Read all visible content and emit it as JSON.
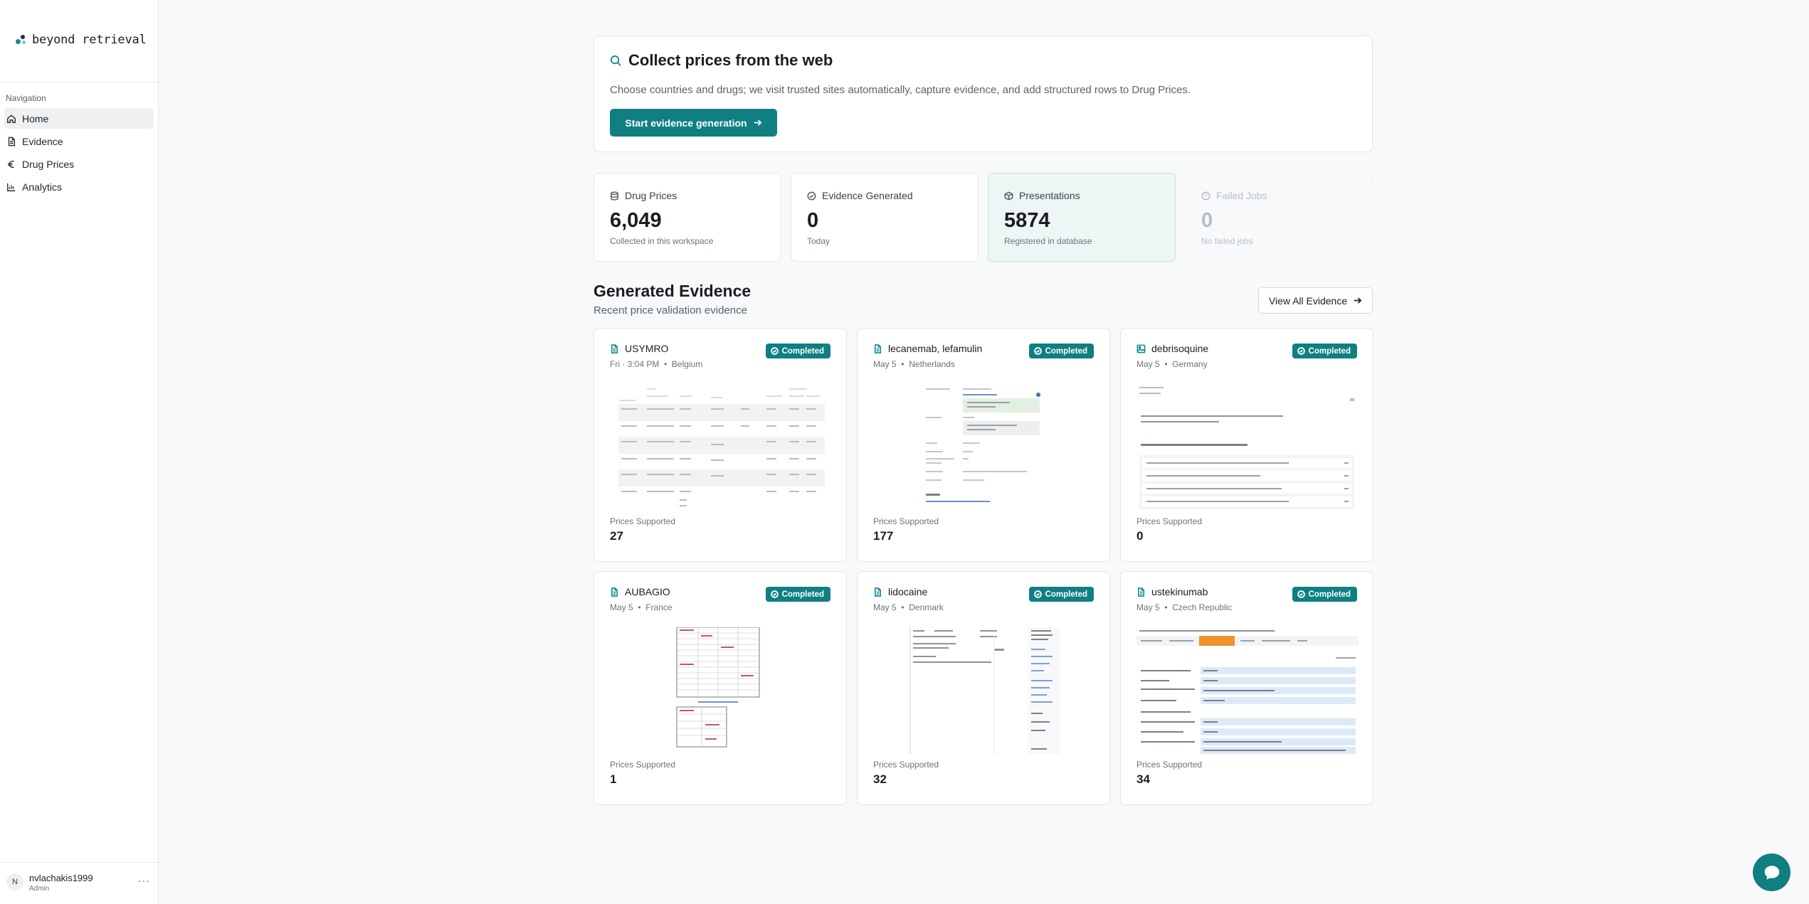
{
  "brand": {
    "name": "beyond retrieval"
  },
  "sidebar": {
    "nav_heading": "Navigation",
    "items": [
      {
        "label": "Home",
        "icon": "home-icon",
        "active": true
      },
      {
        "label": "Evidence",
        "icon": "document-icon",
        "active": false
      },
      {
        "label": "Drug Prices",
        "icon": "euro-icon",
        "active": false
      },
      {
        "label": "Analytics",
        "icon": "bar-chart-icon",
        "active": false
      }
    ],
    "user": {
      "initial": "N",
      "name": "nvlachakis1999",
      "role": "Admin",
      "menu": "···"
    }
  },
  "hero": {
    "title": "Collect prices from the web",
    "description": "Choose countries and drugs; we visit trusted sites automatically, capture evidence, and add structured rows to Drug Prices.",
    "button_label": "Start evidence generation"
  },
  "stats": [
    {
      "label": "Drug Prices",
      "value": "6,049",
      "sub": "Collected in this workspace"
    },
    {
      "label": "Evidence Generated",
      "value": "0",
      "sub": "Today"
    },
    {
      "label": "Presentations",
      "value": "5874",
      "sub": "Registered in database"
    },
    {
      "label": "Failed Jobs",
      "value": "0",
      "sub": "No failed jobs"
    }
  ],
  "section": {
    "title": "Generated Evidence",
    "subtitle": "Recent price validation evidence",
    "view_all_label": "View All Evidence"
  },
  "cards": [
    {
      "title": "USYMRO",
      "date": "Fri · 3:04 PM",
      "country": "Belgium",
      "status": "Completed",
      "prices_label": "Prices Supported",
      "prices": "27",
      "icon": "document-icon"
    },
    {
      "title": "lecanemab, lefamulin",
      "date": "May 5",
      "country": "Netherlands",
      "status": "Completed",
      "prices_label": "Prices Supported",
      "prices": "177",
      "icon": "document-icon"
    },
    {
      "title": "debrisoquine",
      "date": "May 5",
      "country": "Germany",
      "status": "Completed",
      "prices_label": "Prices Supported",
      "prices": "0",
      "icon": "image-icon"
    },
    {
      "title": "AUBAGIO",
      "date": "May 5",
      "country": "France",
      "status": "Completed",
      "prices_label": "Prices Supported",
      "prices": "1",
      "icon": "document-icon"
    },
    {
      "title": "lidocaine",
      "date": "May 5",
      "country": "Denmark",
      "status": "Completed",
      "prices_label": "Prices Supported",
      "prices": "32",
      "icon": "document-icon"
    },
    {
      "title": "ustekinumab",
      "date": "May 5",
      "country": "Czech Republic",
      "status": "Completed",
      "prices_label": "Prices Supported",
      "prices": "34",
      "icon": "document-icon"
    }
  ],
  "separator": "•"
}
